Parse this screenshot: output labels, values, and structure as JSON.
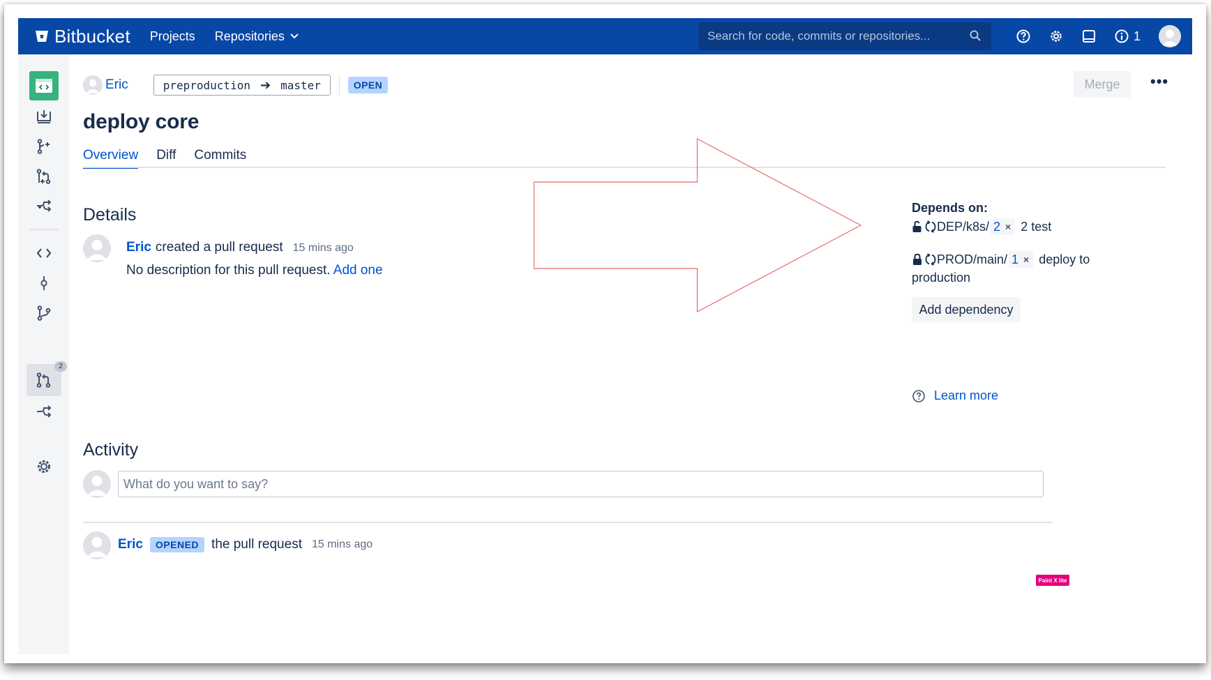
{
  "colors": {
    "nav_bg": "#0747a6",
    "link": "#0052cc",
    "sidebar_bg": "#f4f5f7",
    "repo_icon": "#36b37e",
    "lozenge_bg": "#b3d4ff",
    "annotation": "#e86a6a"
  },
  "topnav": {
    "product": "Bitbucket",
    "links": [
      "Projects",
      "Repositories"
    ],
    "search_placeholder": "Search for code, commits or repositories...",
    "notification_count": "1",
    "icons": [
      "help-icon",
      "gear-icon",
      "inbox-icon",
      "info-icon",
      "avatar"
    ]
  },
  "sidebar": {
    "badge_count": "2",
    "icons": [
      "repo-code-icon",
      "clone-icon",
      "create-branch-icon",
      "create-pr-icon",
      "fork-icon",
      "source-icon",
      "commits-icon",
      "branches-icon",
      "pull-requests-icon",
      "forks-icon",
      "settings-icon"
    ]
  },
  "pr": {
    "author": "Eric",
    "source_branch": "preproduction",
    "target_branch": "master",
    "state": "OPEN",
    "merge_label": "Merge",
    "more_label": "•••",
    "title": "deploy core",
    "tabs": [
      "Overview",
      "Diff",
      "Commits"
    ]
  },
  "details": {
    "heading": "Details",
    "author": "Eric",
    "action": "created a pull request",
    "time": "15 mins ago",
    "description": "No description for this pull request.",
    "add_link": "Add one"
  },
  "dependencies": {
    "title": "Depends on:",
    "items": [
      {
        "path": "DEP/k8s/",
        "number": "2",
        "name": "2 test"
      },
      {
        "path": "PROD/main/",
        "number": "1",
        "name": "deploy to",
        "name_cont": "production"
      }
    ],
    "remove_glyph": "×",
    "add_label": "Add dependency",
    "learn_more": "Learn more"
  },
  "activity": {
    "heading": "Activity",
    "comment_placeholder": "What do you want to say?",
    "event_author": "Eric",
    "event_state": "OPENED",
    "event_text": "the pull request",
    "event_time": "15 mins ago"
  },
  "watermark": "Paint X lite"
}
